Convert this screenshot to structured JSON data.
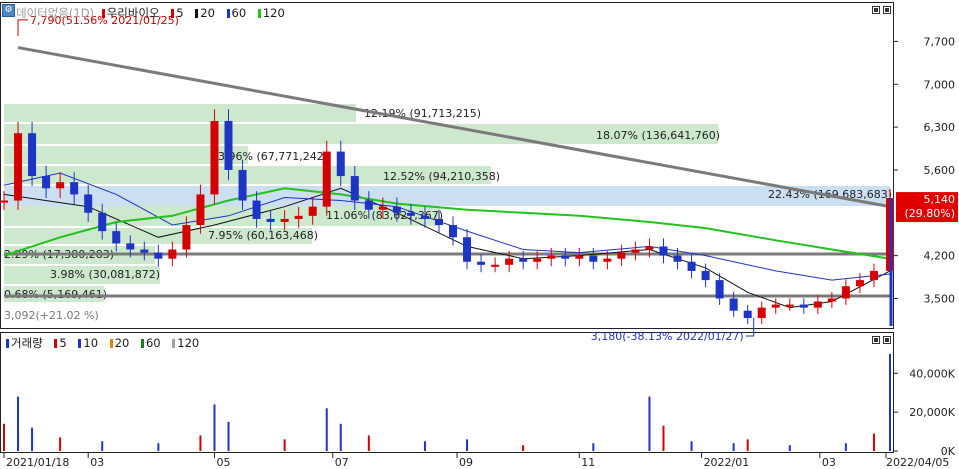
{
  "price_pane": {
    "legend": {
      "series_name": "데이터없음(1D)",
      "stock_name": "우리바이오",
      "ma_items": [
        {
          "label": "5",
          "color": "#d40000"
        },
        {
          "label": "20",
          "color": "#111111"
        },
        {
          "label": "60",
          "color": "#1d34c4"
        },
        {
          "label": "120",
          "color": "#22c21f"
        }
      ]
    },
    "current_price_label": "5,140",
    "current_change_label": "(29.80%)",
    "high_label": "7,790(51.56% 2021/01/25)",
    "low_label": "3,180(-38.13% 2022/01/27)",
    "y_ticks": [
      "7,700",
      "7,000",
      "6,300",
      "5,600",
      "4,200",
      "3,500"
    ],
    "level_labels": [
      "12.19% (91,713,215)",
      "18.07% (136,641,760)",
      "3.96% (67,771,242)",
      "12.52% (94,210,358)",
      "22.43% (169,683,683)",
      "11.06% (83,627,367)",
      "7.95% (60,163,468)",
      "2.29% (17,380,283)",
      "3.98% (30,081,872)",
      "0.68% (5,169,461)"
    ],
    "min_label": "3,092(+21.02 %)"
  },
  "volume_pane": {
    "legend": {
      "title": "거래량",
      "ma_items": [
        {
          "label": "5",
          "color": "#d40000"
        },
        {
          "label": "10",
          "color": "#1d34c4"
        },
        {
          "label": "20",
          "color": "#d68a00"
        },
        {
          "label": "60",
          "color": "#1e7a1e"
        },
        {
          "label": "120",
          "color": "#a0a0a0"
        }
      ]
    },
    "y_ticks": [
      "40,000K",
      "20,000K",
      "0K"
    ]
  },
  "x_axis": {
    "labels": [
      "2021/01/18",
      "03",
      "05",
      "07",
      "09",
      "11",
      "2022/01",
      "03",
      "2022/04/05"
    ]
  },
  "colors": {
    "up": "#d40000",
    "down": "#1d34c4",
    "volume_profile": "#c8e6c8",
    "volume_profile_highlight": "#c5dcef",
    "trendline": "#7a7a7a",
    "support_line": "#7a7a7a"
  },
  "chart_data": [
    {
      "type": "line",
      "title": "우리바이오",
      "subtitle": "",
      "xlabel": "",
      "ylabel": "",
      "x_range": [
        "2021-01-18",
        "2022-04-05"
      ],
      "ylim": [
        3050,
        8050
      ],
      "grid": false,
      "key_points": [
        {
          "date": "2021-01-25",
          "price": 7790
        },
        {
          "date": "2022-01-27",
          "price": 3180
        },
        {
          "date": "2022-04-05",
          "price": 5140
        }
      ],
      "series": [
        {
          "name": "",
          "x": [
            "2021-01-18",
            "2021-01-25",
            "2021-02-01",
            "2021-02-08",
            "2021-02-15",
            "2021-02-22",
            "2021-03-01",
            "2021-03-08",
            "2021-03-15",
            "2021-03-22",
            "2021-03-29",
            "2021-04-05",
            "2021-04-12",
            "2021-04-19",
            "2021-04-26",
            "2021-05-03",
            "2021-05-10",
            "2021-05-17",
            "2021-05-24",
            "2021-05-31",
            "2021-06-07",
            "2021-06-14",
            "2021-06-21",
            "2021-06-28",
            "2021-07-05",
            "2021-07-12",
            "2021-07-19",
            "2021-07-26",
            "2021-08-02",
            "2021-08-09",
            "2021-08-16",
            "2021-08-23",
            "2021-08-30",
            "2021-09-06",
            "2021-09-13",
            "2021-09-20",
            "2021-09-27",
            "2021-10-04",
            "2021-10-11",
            "2021-10-18",
            "2021-10-25",
            "2021-11-01",
            "2021-11-08",
            "2021-11-15",
            "2021-11-22",
            "2021-11-29",
            "2021-12-06",
            "2021-12-13",
            "2021-12-20",
            "2021-12-27",
            "2022-01-03",
            "2022-01-10",
            "2022-01-17",
            "2022-01-24",
            "2022-01-31",
            "2022-02-07",
            "2022-02-14",
            "2022-02-21",
            "2022-02-28",
            "2022-03-07",
            "2022-03-14",
            "2022-03-21",
            "2022-03-28",
            "2022-04-05"
          ],
          "values": [
            5100,
            6200,
            5500,
            5300,
            5400,
            5200,
            4900,
            4600,
            4400,
            4300,
            4250,
            4150,
            4300,
            4700,
            5200,
            6400,
            5600,
            5100,
            4800,
            4750,
            4800,
            4850,
            5000,
            5900,
            5500,
            5100,
            4950,
            5000,
            4900,
            4850,
            4800,
            4700,
            4500,
            4100,
            4050,
            4050,
            4150,
            4100,
            4150,
            4200,
            4150,
            4200,
            4100,
            4150,
            4250,
            4300,
            4350,
            4200,
            4100,
            3950,
            3800,
            3500,
            3300,
            3180,
            3350,
            3400,
            3400,
            3350,
            3450,
            3500,
            3700,
            3800,
            3950,
            5140
          ]
        },
        {
          "name": "",
          "x": [
            "2021-01-18",
            "2021-03-01",
            "2021-04-05",
            "2021-05-03",
            "2021-06-07",
            "2021-07-05",
            "2021-08-02",
            "2021-09-06",
            "2021-10-04",
            "2021-11-01",
            "2021-12-06",
            "2022-01-03",
            "2022-01-24",
            "2022-02-14",
            "2022-03-07",
            "2022-04-05"
          ],
          "values": [
            5200,
            5000,
            4500,
            4700,
            5000,
            5300,
            4900,
            4350,
            4150,
            4200,
            4300,
            4000,
            3600,
            3350,
            3450,
            3950
          ]
        },
        {
          "name": "",
          "x": [
            "2021-01-18",
            "2021-02-15",
            "2021-03-15",
            "2021-04-12",
            "2021-05-10",
            "2021-06-07",
            "2021-07-05",
            "2021-08-02",
            "2021-09-06",
            "2021-10-04",
            "2021-11-01",
            "2021-12-06",
            "2022-01-03",
            "2022-02-07",
            "2022-03-07",
            "2022-04-05"
          ],
          "values": [
            5350,
            5550,
            5200,
            4700,
            4850,
            5150,
            5100,
            5000,
            4600,
            4300,
            4250,
            4350,
            4200,
            3950,
            3800,
            3900
          ]
        },
        {
          "name": "",
          "x": [
            "2021-01-18",
            "2021-02-15",
            "2021-03-15",
            "2021-04-12",
            "2021-05-10",
            "2021-06-07",
            "2021-07-05",
            "2021-08-02",
            "2021-09-06",
            "2021-10-04",
            "2021-11-01",
            "2021-12-06",
            "2022-01-03",
            "2022-02-07",
            "2022-03-07",
            "2022-04-05"
          ],
          "values": [
            4200,
            4500,
            4750,
            4850,
            5100,
            5300,
            5200,
            5050,
            4950,
            4900,
            4850,
            4750,
            4650,
            4450,
            4300,
            4150
          ]
        }
      ]
    },
    {
      "type": "bar",
      "title": "거래량",
      "xlabel": "",
      "ylabel": "",
      "ylim": [
        0,
        52000
      ],
      "x": [
        "2021-01-18",
        "2021-01-25",
        "2021-02-01",
        "2021-02-15",
        "2021-03-08",
        "2021-04-05",
        "2021-04-26",
        "2021-05-03",
        "2021-05-10",
        "2021-06-07",
        "2021-06-28",
        "2021-07-05",
        "2021-07-19",
        "2021-08-16",
        "2021-09-06",
        "2021-10-04",
        "2021-11-08",
        "2021-12-06",
        "2021-12-13",
        "2021-12-27",
        "2022-01-17",
        "2022-01-24",
        "2022-02-14",
        "2022-03-14",
        "2022-03-28",
        "2022-04-05"
      ],
      "values": [
        14000,
        28000,
        12000,
        7000,
        5000,
        4000,
        8000,
        24000,
        15000,
        6000,
        22000,
        14000,
        8000,
        5000,
        6000,
        3000,
        4000,
        28000,
        13000,
        5000,
        4000,
        6000,
        3000,
        4000,
        9000,
        50000
      ]
    }
  ]
}
